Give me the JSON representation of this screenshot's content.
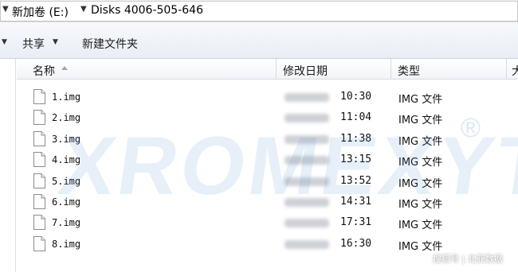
{
  "address_bar": {
    "breadcrumbs": [
      "新加卷 (E:)",
      "Disks 4006-505-646"
    ]
  },
  "toolbar": {
    "share_label": "共享",
    "new_folder_label": "新建文件夹"
  },
  "columns": {
    "name": "名称",
    "modified": "修改日期",
    "type": "类型",
    "size_partial": "大"
  },
  "files": [
    {
      "name": "1.img",
      "time": "10:30",
      "type": "IMG 文件"
    },
    {
      "name": "2.img",
      "time": "11:04",
      "type": "IMG 文件"
    },
    {
      "name": "3.img",
      "time": "11:38",
      "type": "IMG 文件"
    },
    {
      "name": "4.img",
      "time": "13:15",
      "type": "IMG 文件"
    },
    {
      "name": "5.img",
      "time": "13:52",
      "type": "IMG 文件"
    },
    {
      "name": "6.img",
      "time": "14:31",
      "type": "IMG 文件"
    },
    {
      "name": "7.img",
      "time": "17:31",
      "type": "IMG 文件"
    },
    {
      "name": "8.img",
      "time": "16:30",
      "type": "IMG 文件"
    }
  ],
  "watermark": {
    "text": "XROMEXYT",
    "registered": "®"
  },
  "footer_credit": "搜狐号 | 北亚数据",
  "icons": {
    "file": "file-icon",
    "sort": "sort-ascending-icon",
    "breadcrumb_separator": "chevron-down-icon"
  }
}
